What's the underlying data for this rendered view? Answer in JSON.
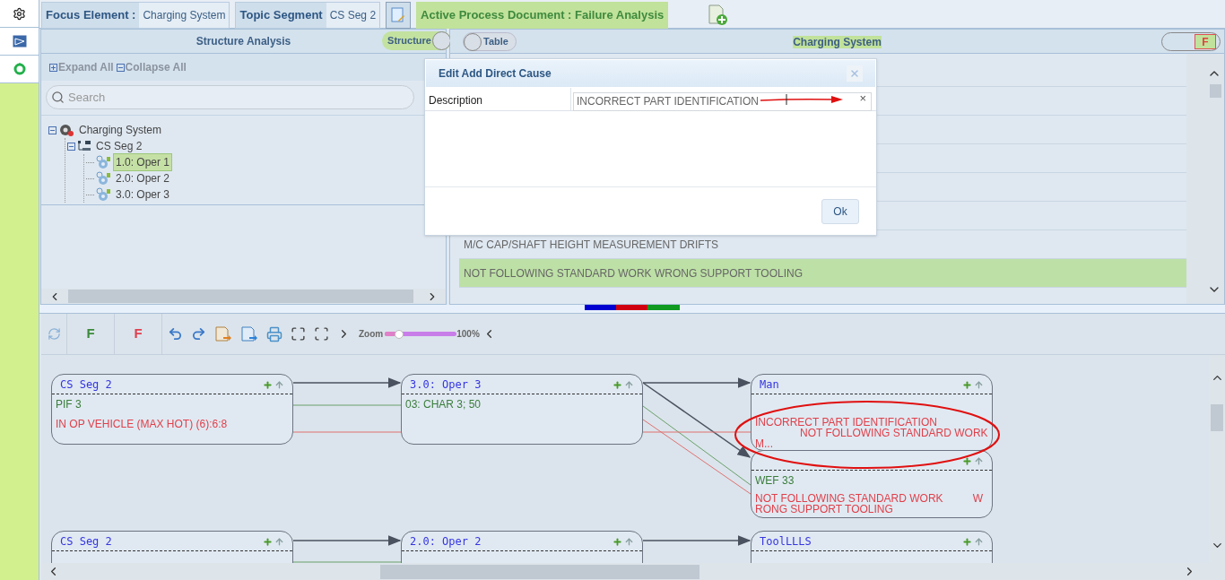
{
  "top_bar": {
    "focus_label": "Focus Element :",
    "focus_value": "Charging System",
    "topic_label": "Topic Segment",
    "topic_value": "CS Seg 2",
    "active_document": "Active Process Document : Failure Analysis"
  },
  "structure_panel": {
    "title": "Structure Analysis",
    "toggle_label": "Structure",
    "expand_all": "Expand All",
    "collapse_all": "Collapse All",
    "search_placeholder": "Search",
    "tree": [
      {
        "label": "Charging System",
        "kind": "system",
        "expanded": true,
        "selected": false,
        "children": [
          {
            "label": "CS Seg 2",
            "kind": "segment",
            "expanded": true,
            "selected": false,
            "children": [
              {
                "label": "1.0: Oper 1",
                "kind": "operation",
                "selected": true
              },
              {
                "label": "2.0: Oper 2",
                "kind": "operation",
                "selected": false
              },
              {
                "label": "3.0: Oper 3",
                "kind": "operation",
                "selected": false
              }
            ]
          }
        ]
      }
    ]
  },
  "table_panel": {
    "toggle_label": "Table",
    "title": "Charging System",
    "filter_label": "F",
    "rows": [
      {
        "text": "M/C CAP/SHAFT HEIGHT MEASUREMENT DRIFTS",
        "selected": false
      },
      {
        "text": "NOT FOLLOWING STANDARD WORK WRONG SUPPORT TOOLING",
        "selected": true
      }
    ]
  },
  "dialog": {
    "title": "Edit Add Direct Cause",
    "field_label": "Description",
    "field_value": "INCORRECT PART IDENTIFICATION",
    "clear": "×",
    "ok": "Ok"
  },
  "toolbar": {
    "filter_green": "F",
    "filter_red": "F",
    "zoom_label": "Zoom",
    "level": 0.2,
    "zoom_value": "100%"
  },
  "diagram": {
    "nodes": [
      {
        "title": "CS Seg 2",
        "items": [
          {
            "text": "PIF 3",
            "kind": "characteristic"
          },
          {
            "text": "IN OP VEHICLE (MAX HOT) (6):6:8",
            "kind": "failure"
          }
        ]
      },
      {
        "title": "3.0: Oper 3",
        "items": [
          {
            "text": "03: CHAR 3; 50",
            "kind": "characteristic"
          }
        ]
      },
      {
        "title": "Man",
        "items": [
          {
            "text": "INCORRECT PART IDENTIFICATION",
            "kind": "failure"
          },
          {
            "text": "NOT FOLLOWING STANDARD WORK",
            "kind": "failure",
            "continued": true
          },
          {
            "text": "M...",
            "kind": "failure"
          }
        ]
      },
      {
        "items": [
          {
            "text": "WEF 33",
            "kind": "characteristic"
          },
          {
            "text": "NOT FOLLOWING STANDARD WORK",
            "kind": "failure",
            "tail": "W"
          },
          {
            "text": "RONG SUPPORT TOOLING",
            "kind": "failure"
          }
        ]
      },
      {
        "title": "CS Seg 2"
      },
      {
        "title": "2.0: Oper 2"
      },
      {
        "title": "ToolLLLS"
      }
    ]
  }
}
